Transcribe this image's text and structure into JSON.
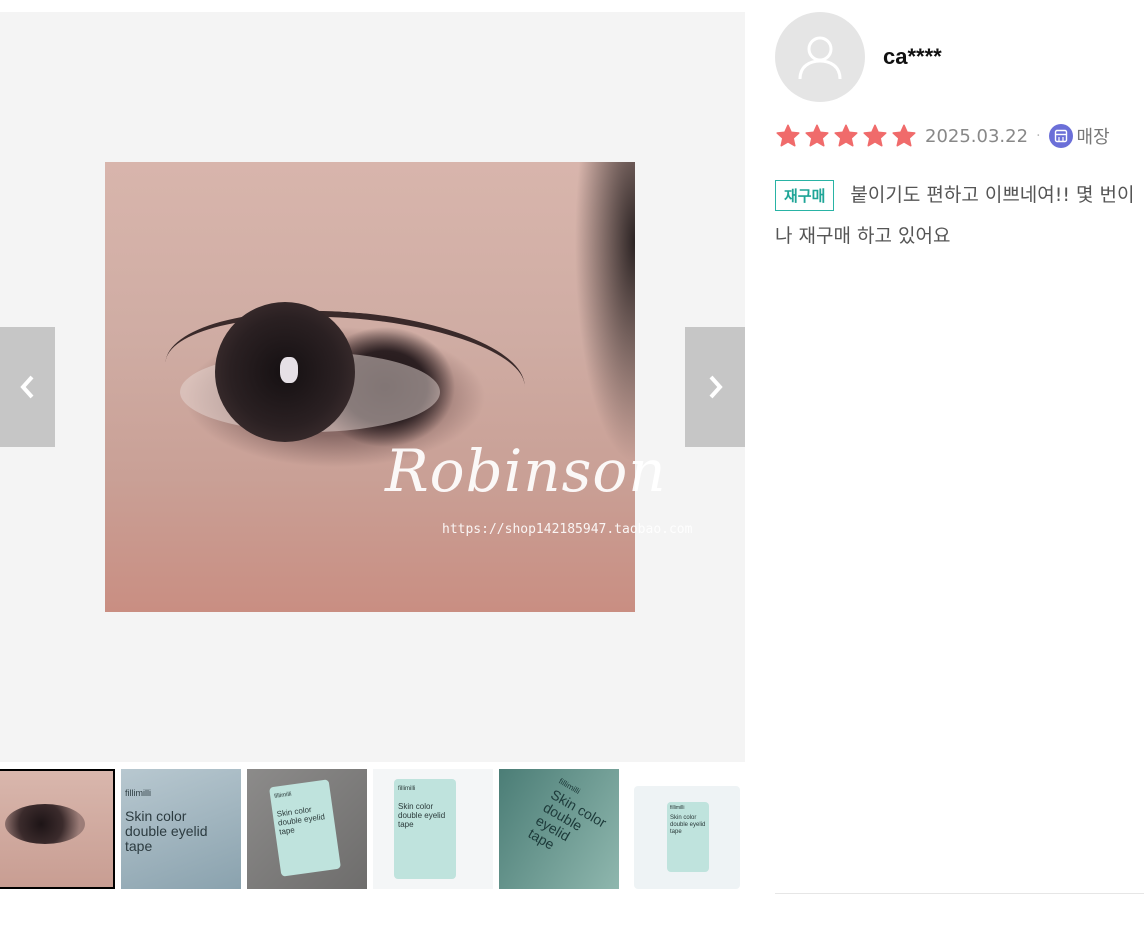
{
  "gallery": {
    "watermark_text": "Robinson",
    "watermark_url": "https://shop142185947.taobao.com",
    "thumbnails": [
      {
        "kind": "eye-photo",
        "active": true
      },
      {
        "kind": "package-photo",
        "caption_lines": [
          "fillimilli",
          "Skin color",
          "double eyelid",
          "tape"
        ]
      },
      {
        "kind": "package-photo",
        "caption_lines": [
          "fillimilli",
          "Skin color",
          "double eyelid",
          "tape"
        ]
      },
      {
        "kind": "package-photo",
        "caption_lines": [
          "fillimilli",
          "Skin color",
          "double eyelid",
          "tape"
        ]
      },
      {
        "kind": "package-photo",
        "caption_lines": [
          "fillimilli",
          "Skin color",
          "double eyelid",
          "tape"
        ]
      },
      {
        "kind": "package-photo",
        "caption_lines": [
          "fillimilli",
          "Skin color",
          "double eyelid",
          "tape"
        ]
      }
    ],
    "prev_icon": "chevron-left-icon",
    "next_icon": "chevron-right-icon"
  },
  "review": {
    "username": "ca****",
    "rating": 5,
    "rating_max": 5,
    "date": "2025.03.22",
    "separator": "·",
    "channel_icon": "store-icon",
    "channel_label": "매장",
    "badge": "재구매",
    "text": "붙이기도 편하고 이쁘네여!! 몇 번이나 재구매 하고 있어요"
  },
  "colors": {
    "star": "#f06b6b",
    "badge": "#1fa597",
    "store_icon_bg": "#6b6fd8"
  }
}
